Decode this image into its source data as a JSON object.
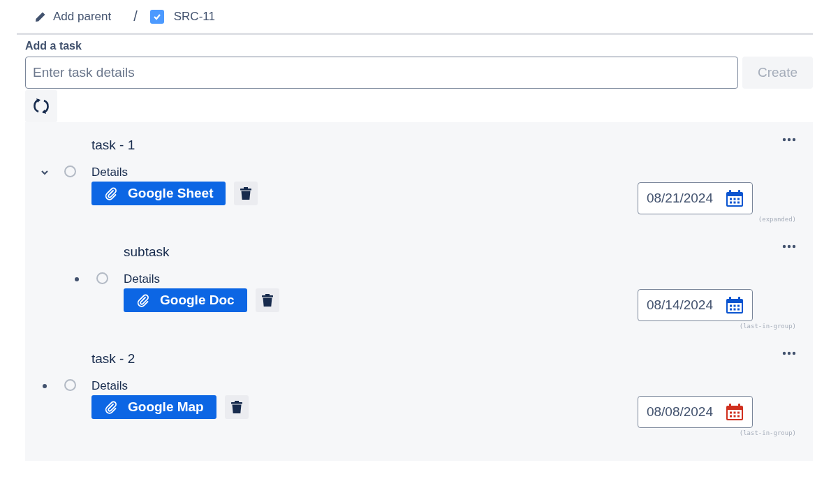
{
  "breadcrumb": {
    "add_parent": "Add parent",
    "separator": "/",
    "issue": {
      "key": "SRC-11",
      "checked": true
    }
  },
  "add_task": {
    "label": "Add a task",
    "placeholder": "Enter task details",
    "create_button": {
      "label": "Create",
      "disabled": true
    }
  },
  "tasks": [
    {
      "title": "task - 1",
      "details": "Details",
      "done": false,
      "expanded": true,
      "attachment": "Google Sheet",
      "date": "08/21/2024",
      "overdue": false,
      "note": "(expanded)",
      "children": [
        {
          "title": "subtask",
          "details": "Details",
          "done": false,
          "attachment": "Google Doc",
          "date": "08/14/2024",
          "overdue": false,
          "note": "(last-in-group)"
        }
      ]
    },
    {
      "title": "task - 2",
      "details": "Details",
      "done": false,
      "attachment": "Google Map",
      "date": "08/08/2024",
      "overdue": true,
      "note": "(last-in-group)"
    }
  ]
}
